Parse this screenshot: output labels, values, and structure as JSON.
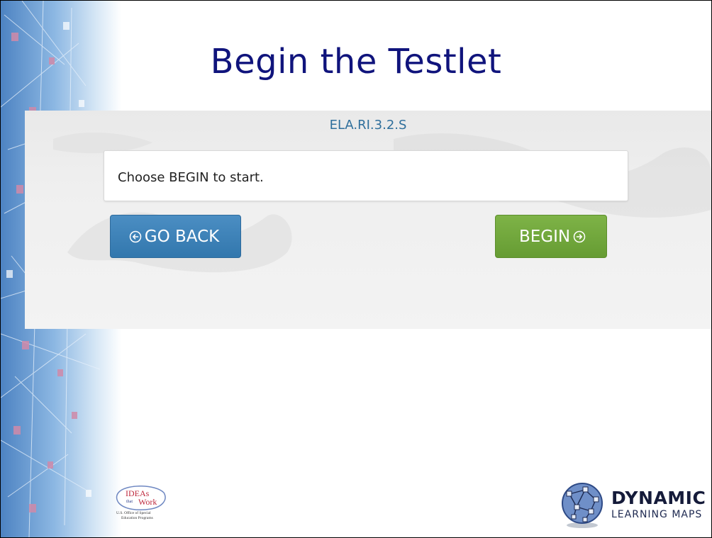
{
  "slide": {
    "title": "Begin the Testlet"
  },
  "testlet": {
    "code": "ELA.RI.3.2.S",
    "prompt": "Choose BEGIN to start.",
    "back_label": "GO BACK",
    "begin_label": "BEGIN"
  },
  "logos": {
    "ideas": {
      "line1": "IDEAs",
      "line2": "that",
      "line3": "Work",
      "caption1": "U.S. Office of Special",
      "caption2": "Education Programs"
    },
    "dlm": {
      "word": "DYNAMIC",
      "subtitle": "LEARNING MAPS"
    }
  },
  "colors": {
    "title": "#10147c",
    "code": "#2f6f9c",
    "back_button": "#3b82b9",
    "begin_button": "#72a83f",
    "network_band": "#6fa2d7"
  },
  "icons": {
    "back": "circle-arrow-left-icon",
    "begin": "circle-arrow-right-icon",
    "network": "network-nodes-decoration",
    "dlm": "globe-network-icon"
  }
}
